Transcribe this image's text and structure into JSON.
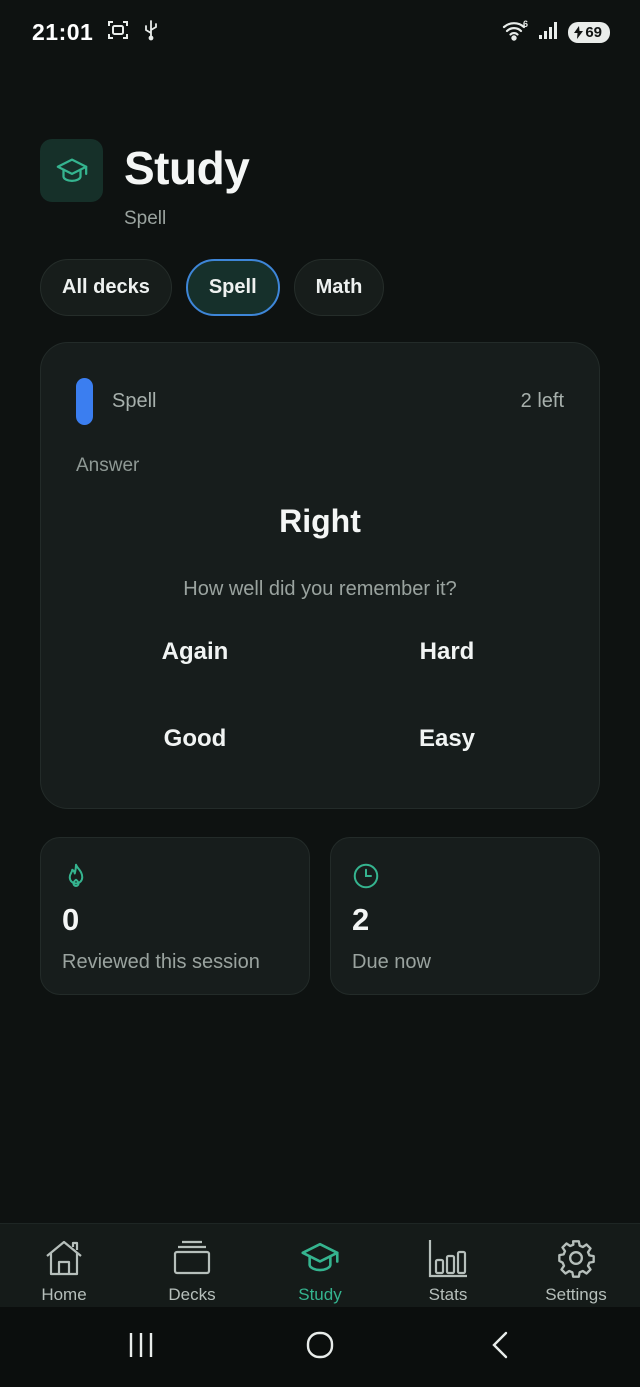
{
  "status_bar": {
    "time": "21:01",
    "battery": "69"
  },
  "header": {
    "title": "Study",
    "subtitle": "Spell"
  },
  "filters": [
    {
      "label": "All decks",
      "active": false
    },
    {
      "label": "Spell",
      "active": true
    },
    {
      "label": "Math",
      "active": false
    }
  ],
  "card": {
    "deck": "Spell",
    "remaining": "2 left",
    "answer_label": "Answer",
    "answer": "Right",
    "prompt": "How well did you remember it?",
    "grades": {
      "again": "Again",
      "hard": "Hard",
      "good": "Good",
      "easy": "Easy"
    },
    "deck_color": "#3b7ef0"
  },
  "stats": {
    "reviewed": {
      "value": "0",
      "label": "Reviewed this session"
    },
    "due": {
      "value": "2",
      "label": "Due now"
    }
  },
  "nav": {
    "home": "Home",
    "decks": "Decks",
    "study": "Study",
    "stats": "Stats",
    "settings": "Settings",
    "active": "study"
  },
  "colors": {
    "accent": "#35b48f",
    "selection": "#3e86d8",
    "background": "#0e1211"
  }
}
